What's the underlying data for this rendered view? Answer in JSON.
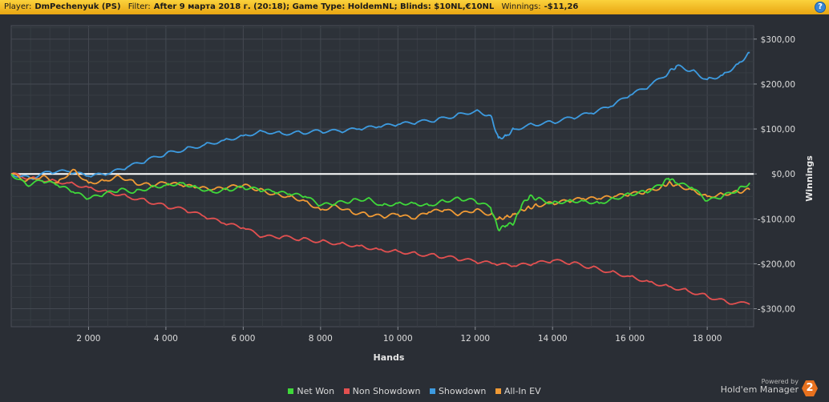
{
  "header": {
    "player_label": "Player:",
    "player_value": "DmPechenyuk (PS)",
    "filter_label": "Filter:",
    "filter_value": "After 9 марта 2018 г. (20:18); Game Type: HoldemNL; Blinds: $10NL,€10NL",
    "winnings_label": "Winnings:",
    "winnings_value": "-$11,26",
    "help_glyph": "?"
  },
  "footer": {
    "powered_by": "Powered by",
    "brand": "Hold'em Manager",
    "brand_version": "2"
  },
  "chart_data": {
    "type": "line",
    "xlabel": "Hands",
    "ylabel": "Winnings",
    "xlim": [
      0,
      19200
    ],
    "ylim": [
      -340,
      330
    ],
    "x_ticks": [
      2000,
      4000,
      6000,
      8000,
      10000,
      12000,
      14000,
      16000,
      18000
    ],
    "x_tick_labels": [
      "2 000",
      "4 000",
      "6 000",
      "8 000",
      "10 000",
      "12 000",
      "14 000",
      "16 000",
      "18 000"
    ],
    "y_ticks": [
      300,
      200,
      100,
      0,
      -100,
      -200,
      -300
    ],
    "y_tick_labels": [
      "$300,00",
      "$200,00",
      "$100,00",
      "$0,00",
      "-$100,00",
      "-$200,00",
      "-$300,00"
    ],
    "grid": true,
    "legend_position": "bottom",
    "series": [
      {
        "name": "Net Won",
        "color": "#3fd83a",
        "x": [
          0,
          400,
          800,
          1200,
          1600,
          2000,
          2400,
          2800,
          3200,
          3600,
          4000,
          4400,
          4800,
          5200,
          5600,
          6000,
          6400,
          6800,
          7200,
          7600,
          8000,
          8400,
          8800,
          9200,
          9600,
          10000,
          10400,
          10800,
          11200,
          11600,
          12000,
          12400,
          12600,
          12800,
          13000,
          13200,
          13400,
          13600,
          14000,
          14400,
          14800,
          15200,
          15600,
          16000,
          16400,
          16800,
          17000,
          17200,
          17600,
          18000,
          18400,
          18800,
          19100
        ],
        "y": [
          0,
          -25,
          -15,
          -25,
          -40,
          -55,
          -45,
          -35,
          -40,
          -30,
          -25,
          -20,
          -30,
          -40,
          -35,
          -30,
          -35,
          -40,
          -45,
          -50,
          -70,
          -65,
          -60,
          -55,
          -70,
          -65,
          -65,
          -70,
          -60,
          -55,
          -60,
          -75,
          -125,
          -115,
          -110,
          -70,
          -50,
          -55,
          -65,
          -60,
          -60,
          -65,
          -55,
          -45,
          -40,
          -25,
          -10,
          -20,
          -30,
          -60,
          -50,
          -35,
          -20
        ]
      },
      {
        "name": "Non Showdown",
        "color": "#e35050",
        "x": [
          0,
          500,
          1000,
          1500,
          2000,
          2500,
          3000,
          3500,
          4000,
          4500,
          5000,
          5500,
          6000,
          6500,
          7000,
          7500,
          8000,
          8500,
          9000,
          9500,
          10000,
          10500,
          11000,
          11500,
          12000,
          12500,
          13000,
          13500,
          14000,
          14500,
          15000,
          15500,
          16000,
          16500,
          17000,
          17500,
          18000,
          18500,
          19100
        ],
        "y": [
          0,
          -10,
          -15,
          -20,
          -30,
          -40,
          -50,
          -60,
          -72,
          -80,
          -95,
          -110,
          -120,
          -140,
          -140,
          -145,
          -150,
          -155,
          -160,
          -168,
          -172,
          -178,
          -182,
          -188,
          -195,
          -200,
          -205,
          -200,
          -193,
          -198,
          -208,
          -218,
          -228,
          -240,
          -250,
          -260,
          -272,
          -285,
          -290
        ]
      },
      {
        "name": "Showdown",
        "color": "#3d9be0",
        "x": [
          0,
          500,
          1000,
          1500,
          2000,
          2500,
          3000,
          3500,
          4000,
          4500,
          5000,
          5500,
          6000,
          6500,
          7000,
          7500,
          8000,
          8500,
          9000,
          9500,
          10000,
          10500,
          11000,
          11500,
          12000,
          12400,
          12600,
          12800,
          13000,
          13500,
          14000,
          14500,
          15000,
          15500,
          16000,
          16500,
          17000,
          17200,
          17600,
          18000,
          18400,
          18800,
          19100
        ],
        "y": [
          0,
          -10,
          5,
          5,
          -5,
          0,
          15,
          30,
          45,
          55,
          65,
          75,
          85,
          95,
          90,
          92,
          95,
          95,
          100,
          105,
          110,
          115,
          120,
          130,
          140,
          130,
          80,
          85,
          100,
          110,
          115,
          125,
          135,
          150,
          175,
          195,
          225,
          240,
          230,
          210,
          220,
          245,
          270
        ]
      },
      {
        "name": "All-In EV",
        "color": "#f09a35",
        "x": [
          0,
          400,
          800,
          1200,
          1600,
          2000,
          2400,
          2800,
          3200,
          3600,
          4000,
          4400,
          4800,
          5200,
          5600,
          6000,
          6400,
          6800,
          7200,
          7600,
          8000,
          8400,
          8800,
          9200,
          9600,
          10000,
          10400,
          10800,
          11200,
          11600,
          12000,
          12400,
          12600,
          12800,
          13000,
          13200,
          13400,
          13600,
          14000,
          14400,
          14800,
          15200,
          15600,
          16000,
          16400,
          16800,
          17000,
          17200,
          17600,
          18000,
          18400,
          18800,
          19100
        ],
        "y": [
          0,
          -15,
          -5,
          -20,
          10,
          -20,
          -15,
          -5,
          -20,
          -25,
          -20,
          -25,
          -30,
          -35,
          -30,
          -25,
          -35,
          -45,
          -50,
          -60,
          -80,
          -70,
          -85,
          -90,
          -95,
          -90,
          -100,
          -85,
          -80,
          -90,
          -80,
          -90,
          -100,
          -95,
          -90,
          -80,
          -75,
          -70,
          -65,
          -60,
          -55,
          -55,
          -50,
          -45,
          -40,
          -30,
          -20,
          -25,
          -35,
          -50,
          -45,
          -40,
          -35
        ]
      }
    ]
  }
}
